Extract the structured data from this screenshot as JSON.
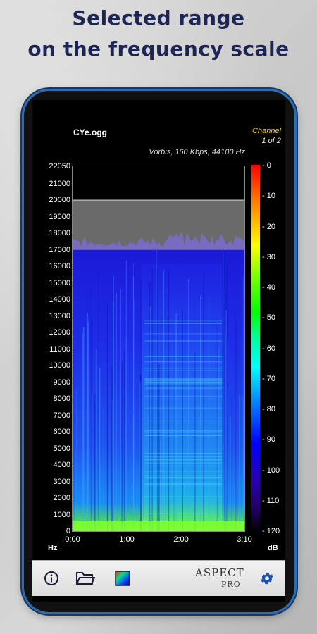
{
  "headline": {
    "line1": "Selected range",
    "line2": "on the frequency scale"
  },
  "app": {
    "file_name": "CYe.ogg",
    "codec_info": "Vorbis, 160 Kbps, 44100 Hz",
    "channel_label": "Channel",
    "channel_page": "1 of 2",
    "brand_name": "ASPECT",
    "brand_edition": "PRO"
  },
  "toolbar": {
    "info_icon": "info-icon",
    "folder_icon": "folder-open-icon",
    "palette_icon": "color-palette-icon",
    "settings_icon": "gear-icon",
    "accent_color": "#1a4fb5"
  },
  "chart_data": {
    "type": "heatmap",
    "y_unit": "Hz",
    "x_labels": [
      "0:00",
      "1:00",
      "2:00",
      "3:10"
    ],
    "x_range_seconds": [
      0,
      190
    ],
    "y_ticks": [
      22050,
      21000,
      20000,
      19000,
      18000,
      17000,
      16000,
      15000,
      14000,
      13000,
      12000,
      11000,
      10000,
      9000,
      8000,
      7000,
      6000,
      5000,
      4000,
      3000,
      2000,
      1000,
      0
    ],
    "y_range": [
      0,
      22050
    ],
    "selected_range_hz": [
      17000,
      20000
    ],
    "content_cutoff_hz": 17000,
    "colorbar_unit": "dB",
    "colorbar_ticks": [
      "- 0",
      "- 10",
      "- 20",
      "- 30",
      "- 40",
      "- 50",
      "- 60",
      "- 70",
      "- 80",
      "- 90",
      "- 100",
      "- 110",
      "- 120"
    ],
    "colorbar_range_db": [
      -120,
      0
    ]
  }
}
